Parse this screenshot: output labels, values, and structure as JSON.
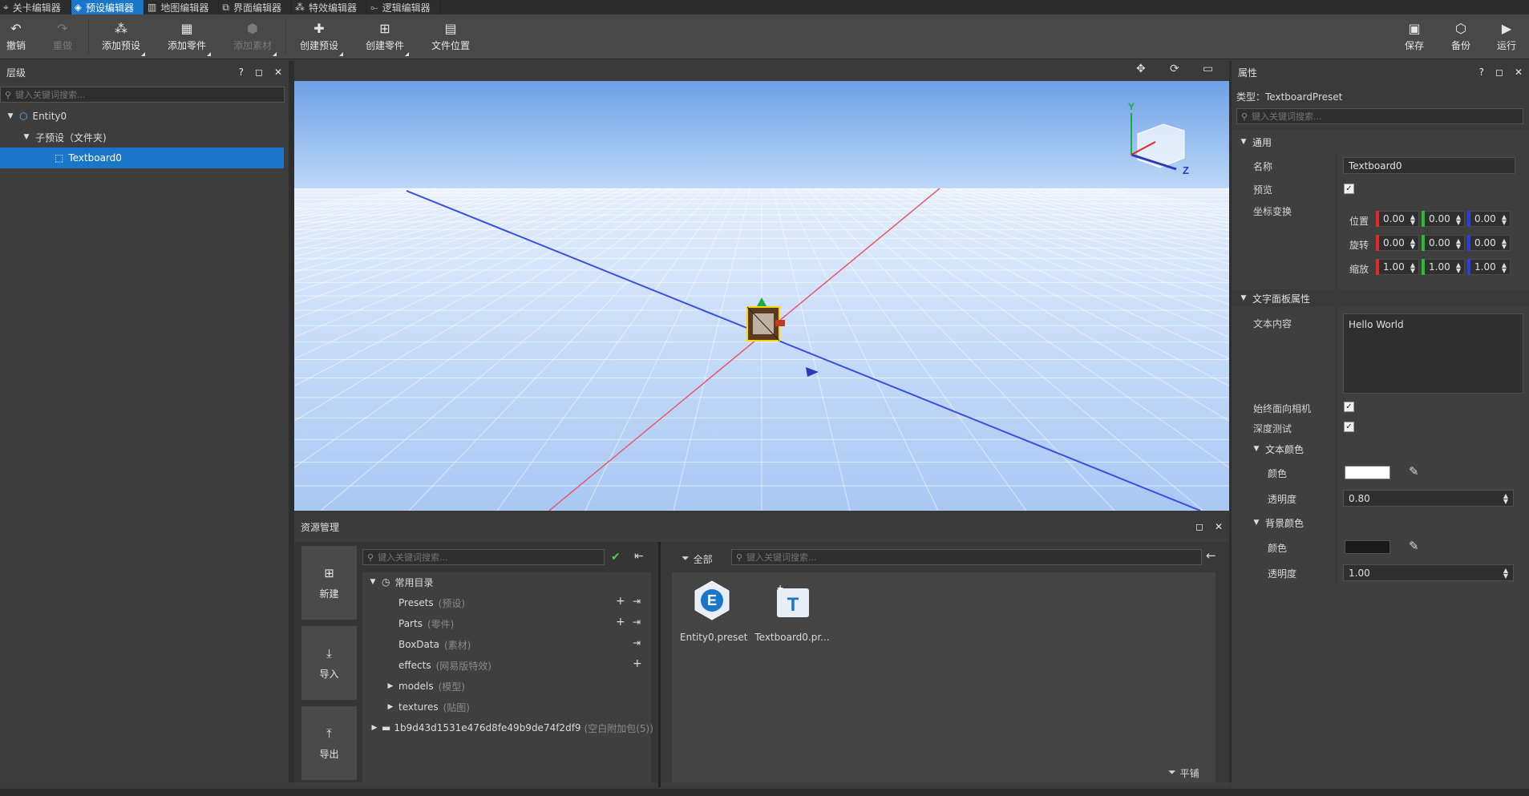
{
  "tabs": [
    {
      "label": "关卡编辑器",
      "icon": "level-icon",
      "active": false
    },
    {
      "label": "预设编辑器",
      "icon": "preset-icon",
      "active": true
    },
    {
      "label": "地图编辑器",
      "icon": "map-icon",
      "active": false
    },
    {
      "label": "界面编辑器",
      "icon": "ui-icon",
      "active": false
    },
    {
      "label": "特效编辑器",
      "icon": "effects-icon",
      "active": false
    },
    {
      "label": "逻辑编辑器",
      "icon": "logic-icon",
      "active": false
    }
  ],
  "toolbar": {
    "undo": "撤销",
    "redo": "重做",
    "add_preset": "添加预设",
    "add_part": "添加零件",
    "add_material": "添加素材",
    "create_preset": "创建预设",
    "create_part": "创建零件",
    "file_location": "文件位置",
    "save": "保存",
    "backup": "备份",
    "run": "运行"
  },
  "hierarchy": {
    "title": "层级",
    "search_placeholder": "键入关键词搜索...",
    "items": [
      {
        "label": "Entity0",
        "depth": 0
      },
      {
        "label": "子预设（文件夹)",
        "depth": 1
      },
      {
        "label": "Textboard0",
        "depth": 2,
        "selected": true
      }
    ]
  },
  "viewport": {
    "axis_y": "Y",
    "axis_z": "Z"
  },
  "assets": {
    "title": "资源管理",
    "search_placeholder": "键入关键词搜索...",
    "buttons": [
      "新建",
      "导入",
      "导出"
    ],
    "common_dir": "常用目录",
    "tree": [
      {
        "name": "Presets",
        "sub": "(预设)"
      },
      {
        "name": "Parts",
        "sub": "(零件)"
      },
      {
        "name": "BoxData",
        "sub": "(素材)"
      },
      {
        "name": "effects",
        "sub": "(网易版特效)"
      },
      {
        "name": "models",
        "sub": "(模型)"
      },
      {
        "name": "textures",
        "sub": "(贴图)"
      }
    ],
    "pack": {
      "name": "1b9d43d1531e476d8fe49b9de74f2df9",
      "sub": "(空白附加包(5))"
    },
    "filter_all": "全部",
    "files_search_placeholder": "键入关键词搜索...",
    "files": [
      "Entity0.preset",
      "Textboard0.pr..."
    ],
    "tile_view": "平铺"
  },
  "properties": {
    "title": "属性",
    "type_label": "类型：TextboardPreset",
    "search_placeholder": "键入关键词搜索...",
    "general": "通用",
    "name_label": "名称",
    "name_value": "Textboard0",
    "preview_label": "预览",
    "transform_label": "坐标变换",
    "position_label": "位置",
    "rotation_label": "旋转",
    "scale_label": "缩放",
    "position": [
      "0.00",
      "0.00",
      "0.00"
    ],
    "rotation": [
      "0.00",
      "0.00",
      "0.00"
    ],
    "scale": [
      "1.00",
      "1.00",
      "1.00"
    ],
    "text_section": "文字面板属性",
    "text_content_label": "文本内容",
    "text_content": "Hello World",
    "face_camera_label": "始终面向相机",
    "depth_test_label": "深度测试",
    "text_color_section": "文本颜色",
    "color_label": "颜色",
    "opacity_label": "透明度",
    "text_opacity": "0.80",
    "bg_color_section": "背景颜色",
    "bg_color_label": "颜色",
    "bg_opacity_label": "透明度",
    "bg_opacity": "1.00",
    "text_color": "#ffffff",
    "bg_color": "#1a1a1a"
  },
  "colors": {
    "accent": "#1a76c9",
    "x_axis": "#e02a2a",
    "y_axis": "#22c02a",
    "z_axis": "#2a40e0"
  }
}
